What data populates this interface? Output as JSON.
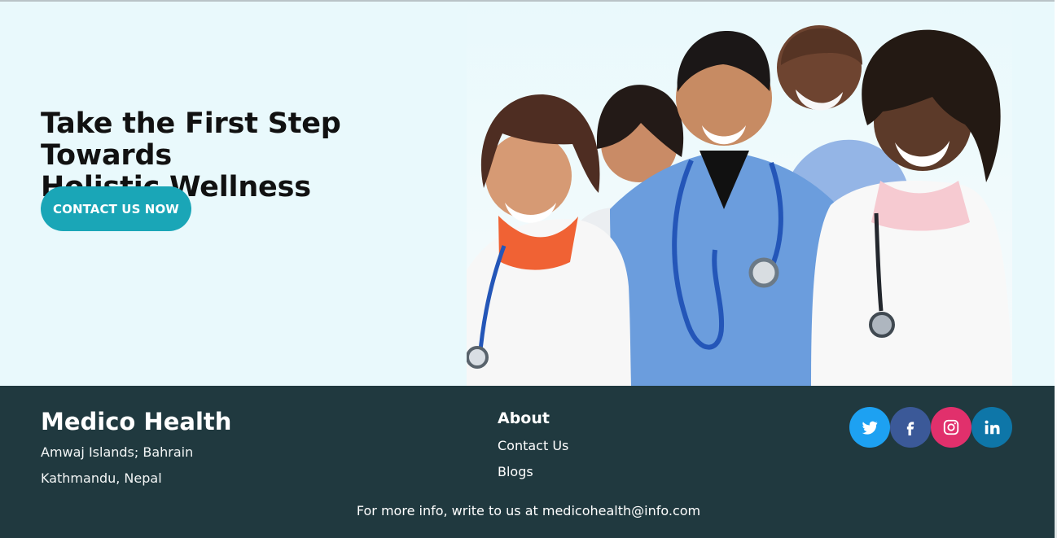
{
  "hero": {
    "title_line1": "Take the First Step Towards",
    "title_line2": "Holistic Wellness",
    "cta_label": "CONTACT US NOW",
    "accent_color": "#1aa6b7",
    "background_color": "#e9f9fc"
  },
  "footer": {
    "brand": "Medico Health",
    "address_line1": "Amwaj Islands; Bahrain",
    "address_line2": "Kathmandu, Nepal",
    "about_heading": "About",
    "links": [
      "Contact Us",
      "Blogs"
    ],
    "info_prefix": "For more info, write to us at ",
    "email": "medicohealth@info.com",
    "background_color": "#20393f",
    "social": [
      {
        "name": "twitter-icon",
        "color": "#1da1f2"
      },
      {
        "name": "facebook-icon",
        "color": "#3b5998"
      },
      {
        "name": "instagram-icon",
        "color": "#e1306c"
      },
      {
        "name": "linkedin-icon",
        "color": "#0e76a8"
      }
    ]
  }
}
